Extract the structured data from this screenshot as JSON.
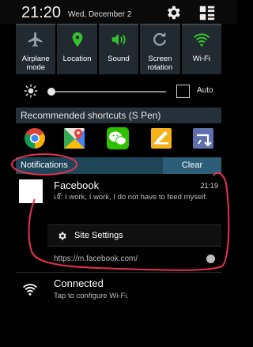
{
  "status_bar": {
    "time": "21:20",
    "date": "Wed, December 2",
    "icons": [
      "gear-icon",
      "grid-list-icon"
    ]
  },
  "quick_toggles": [
    {
      "label": "Airplane mode",
      "icon": "airplane-icon"
    },
    {
      "label": "Location",
      "icon": "location-pin-icon"
    },
    {
      "label": "Sound",
      "icon": "speaker-icon"
    },
    {
      "label": "Screen rotation",
      "icon": "rotation-icon"
    },
    {
      "label": "Wi-Fi",
      "icon": "wifi-icon"
    }
  ],
  "brightness": {
    "level": 0.02,
    "auto_label": "Auto",
    "auto_checked": false
  },
  "shortcuts": {
    "title": "Recommended shortcuts (S Pen)",
    "apps": [
      "chrome-icon",
      "maps-icon",
      "wechat-icon",
      "memo-icon",
      "pen-window-icon"
    ]
  },
  "notifications": {
    "title": "Notifications",
    "clear_label": "Clear",
    "facebook": {
      "app": "Facebook",
      "time": "21:19",
      "message": "เจ๊: I work, I work, I do not have to feed myself.",
      "action_label": "Site Settings",
      "url": "https://m.facebook.com/"
    },
    "wifi": {
      "title": "Connected",
      "subtitle": "Tap to configure Wi-Fi."
    }
  },
  "colors": {
    "toggle_bg": "#222a31",
    "toggle_active": "#35c22e",
    "notif_bar": "#1f4658",
    "clear_btn": "#2c5f77",
    "annotation": "#e8324f"
  }
}
